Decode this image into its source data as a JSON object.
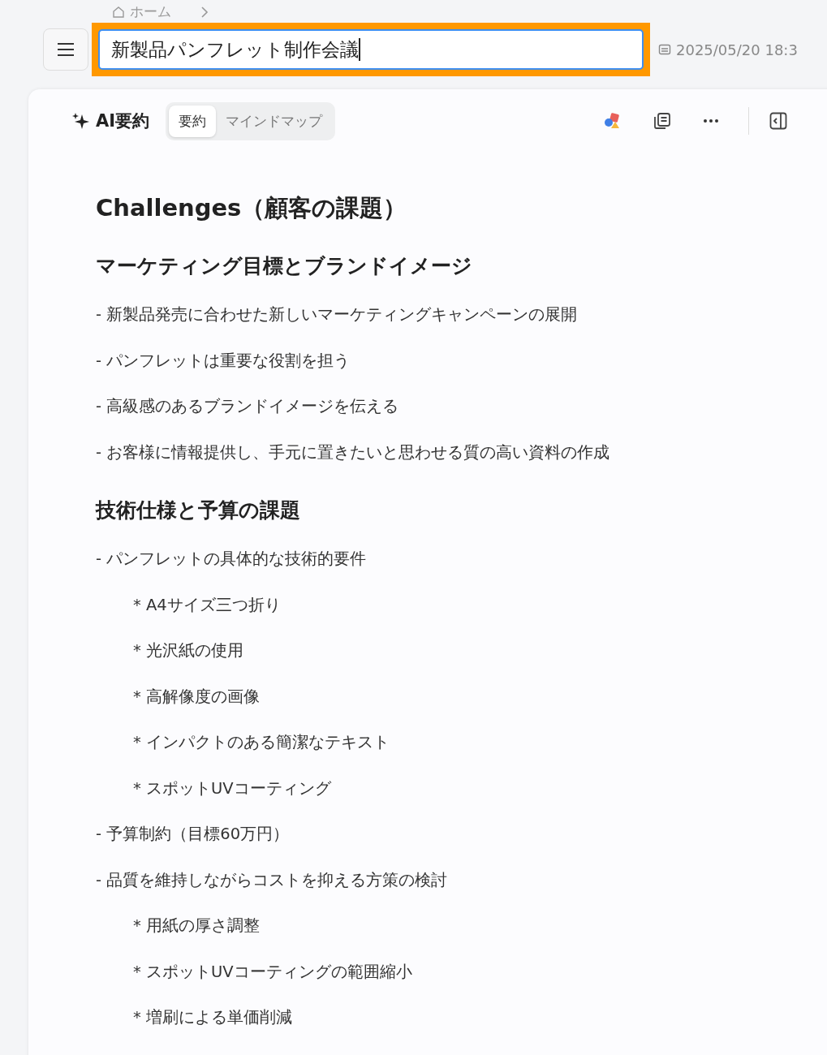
{
  "breadcrumb": {
    "label": "ホーム"
  },
  "title_field": {
    "value": "新製品パンフレット制作会議",
    "highlighted": true
  },
  "date": "2025/05/20 18:3",
  "toolbar": {
    "title": "AI要約",
    "tabs": [
      {
        "label": "要約",
        "selected": true
      },
      {
        "label": "マインドマップ",
        "selected": false
      }
    ]
  },
  "blocks": [
    {
      "kind": "h1",
      "text": "Challenges（顧客の課題）"
    },
    {
      "kind": "h2",
      "text": "マーケティング目標とブランドイメージ"
    },
    {
      "kind": "bullet",
      "text": "- 新製品発売に合わせた新しいマーケティングキャンペーンの展開"
    },
    {
      "kind": "bullet",
      "text": "- パンフレットは重要な役割を担う"
    },
    {
      "kind": "bullet",
      "text": "- 高級感のあるブランドイメージを伝える"
    },
    {
      "kind": "bullet",
      "text": "- お客様に情報提供し、手元に置きたいと思わせる質の高い資料の作成"
    },
    {
      "kind": "h2",
      "text": "技術仕様と予算の課題"
    },
    {
      "kind": "bullet",
      "text": "- パンフレットの具体的な技術的要件"
    },
    {
      "kind": "sub",
      "text": "* A4サイズ三つ折り"
    },
    {
      "kind": "sub",
      "text": "* 光沢紙の使用"
    },
    {
      "kind": "sub",
      "text": "* 高解像度の画像"
    },
    {
      "kind": "sub",
      "text": "* インパクトのある簡潔なテキスト"
    },
    {
      "kind": "sub",
      "text": "* スポットUVコーティング"
    },
    {
      "kind": "bullet",
      "text": "- 予算制約（目標60万円）"
    },
    {
      "kind": "bullet",
      "text": "- 品質を維持しながらコストを抑える方策の検討"
    },
    {
      "kind": "sub",
      "text": "* 用紙の厚さ調整"
    },
    {
      "kind": "sub",
      "text": "* スポットUVコーティングの範囲縮小"
    },
    {
      "kind": "sub",
      "text": "* 増刷による単価削減"
    }
  ]
}
